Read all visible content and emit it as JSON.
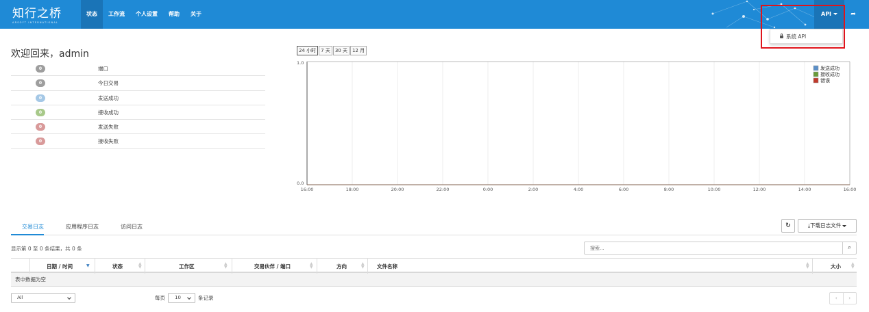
{
  "brand": {
    "name": "知行之桥",
    "tagline": "ARSOFT INTERNATIONAL"
  },
  "nav": {
    "items": [
      "状态",
      "工作流",
      "个人设置",
      "帮助",
      "关于"
    ],
    "active": "状态"
  },
  "api_menu": {
    "label": "API",
    "items": [
      "系统 API"
    ]
  },
  "welcome": {
    "title": "欢迎回来，admin"
  },
  "stats": [
    {
      "count": "0",
      "label": "端口",
      "color": "#9e9e9e"
    },
    {
      "count": "0",
      "label": "今日交易",
      "color": "#9e9e9e"
    },
    {
      "count": "0",
      "label": "发送成功",
      "color": "#a5c8e6"
    },
    {
      "count": "0",
      "label": "接收成功",
      "color": "#a8c98a"
    },
    {
      "count": "0",
      "label": "发送失败",
      "color": "#d99a9a"
    },
    {
      "count": "0",
      "label": "接收失败",
      "color": "#d99a9a"
    }
  ],
  "range_buttons": {
    "items": [
      "24 小时",
      "7 天",
      "30 天",
      "12 月"
    ],
    "active": "24 小时"
  },
  "chart_data": {
    "type": "line",
    "x": [
      "16:00",
      "18:00",
      "20:00",
      "22:00",
      "0:00",
      "2:00",
      "4:00",
      "6:00",
      "8:00",
      "10:00",
      "12:00",
      "14:00",
      "16:00"
    ],
    "ylim": [
      0.0,
      1.0
    ],
    "yticks": [
      "1.0",
      "0.0"
    ],
    "series": [
      {
        "name": "发送成功",
        "color": "#5b8fc7",
        "values": [
          0,
          0,
          0,
          0,
          0,
          0,
          0,
          0,
          0,
          0,
          0,
          0,
          0
        ]
      },
      {
        "name": "接收成功",
        "color": "#6a9b3a",
        "values": [
          0,
          0,
          0,
          0,
          0,
          0,
          0,
          0,
          0,
          0,
          0,
          0,
          0
        ]
      },
      {
        "name": "错误",
        "color": "#c0392b",
        "values": [
          0,
          0,
          0,
          0,
          0,
          0,
          0,
          0,
          0,
          0,
          0,
          0,
          0
        ]
      }
    ],
    "grid": true,
    "legend": "top-right"
  },
  "logs": {
    "tabs": [
      "交易日志",
      "应用程序日志",
      "访问日志"
    ],
    "active_tab": "交易日志",
    "download_label": "下载日志文件",
    "results_info": "显示第 0 至 0 条结果，共 0 条",
    "search_placeholder": "搜索...",
    "columns": [
      "日期 / 时间",
      "状态",
      "工作区",
      "交易伙伴 / 端口",
      "方向",
      "文件名称",
      "大小"
    ],
    "empty_text": "表中数据为空",
    "filter_value": "All",
    "per_page_prefix": "每页",
    "per_page_value": "10",
    "per_page_suffix": "条记录"
  }
}
